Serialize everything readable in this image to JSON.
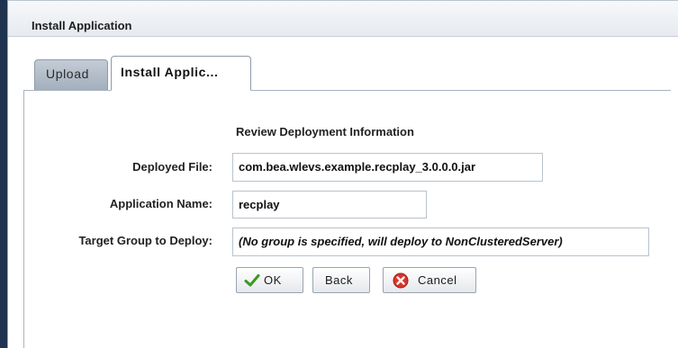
{
  "panel": {
    "title": "Install Application"
  },
  "tabs": [
    {
      "label": "Upload",
      "active": false
    },
    {
      "label": "Install Applic...",
      "active": true
    }
  ],
  "form": {
    "heading": "Review Deployment Information",
    "fields": [
      {
        "label": "Deployed File:",
        "value": "com.bea.wlevs.example.recplay_3.0.0.0.jar"
      },
      {
        "label": "Application Name:",
        "value": "recplay"
      },
      {
        "label": "Target Group to Deploy:",
        "value": "(No group is specified, will deploy to NonClusteredServer)"
      }
    ]
  },
  "buttons": {
    "ok": {
      "label": "OK",
      "icon": "checkmark-icon"
    },
    "back": {
      "label": "Back"
    },
    "cancel": {
      "label": "Cancel",
      "icon": "cancel-icon"
    }
  },
  "colors": {
    "ok_icon": "#3a9a1f",
    "cancel_icon": "#d9342b",
    "tab_inactive": "#aeb9c6",
    "window_edge": "#1f3350"
  }
}
